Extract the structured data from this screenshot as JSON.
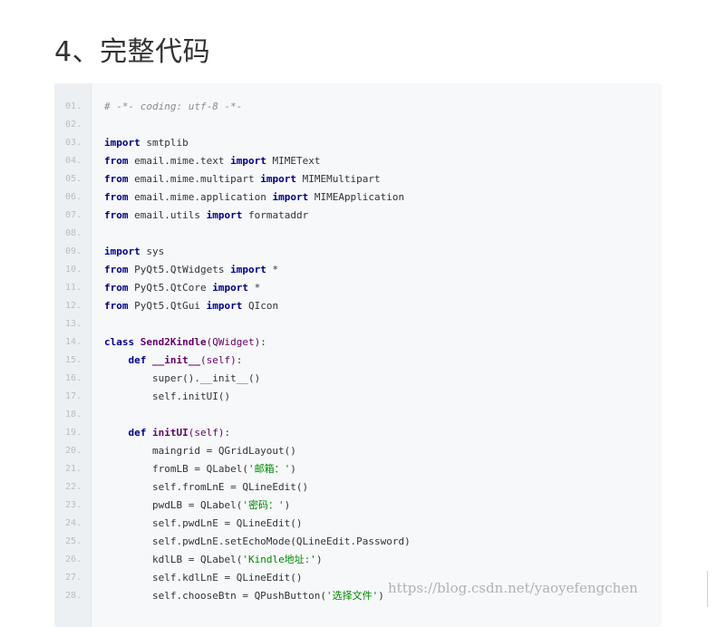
{
  "heading": "4、完整代码",
  "watermark": "https://blog.csdn.net/yaoyefengchen",
  "colors": {
    "code_bg": "#f6f8fa",
    "keyword": "#000088",
    "comment": "#8c8c8c",
    "string": "#008800",
    "func": "#660066"
  },
  "code_lines": [
    {
      "num": "01.",
      "tokens": [
        {
          "t": "# -*- coding: utf-8 -*-",
          "c": "cm"
        }
      ]
    },
    {
      "num": "02.",
      "tokens": []
    },
    {
      "num": "03.",
      "tokens": [
        {
          "t": "import",
          "c": "kw"
        },
        {
          "t": " smtplib",
          "c": ""
        }
      ]
    },
    {
      "num": "04.",
      "tokens": [
        {
          "t": "from",
          "c": "kw"
        },
        {
          "t": " email.mime.text ",
          "c": ""
        },
        {
          "t": "import",
          "c": "kw"
        },
        {
          "t": " MIMEText",
          "c": ""
        }
      ]
    },
    {
      "num": "05.",
      "tokens": [
        {
          "t": "from",
          "c": "kw"
        },
        {
          "t": " email.mime.multipart ",
          "c": ""
        },
        {
          "t": "import",
          "c": "kw"
        },
        {
          "t": " MIMEMultipart",
          "c": ""
        }
      ]
    },
    {
      "num": "06.",
      "tokens": [
        {
          "t": "from",
          "c": "kw"
        },
        {
          "t": " email.mime.application ",
          "c": ""
        },
        {
          "t": "import",
          "c": "kw"
        },
        {
          "t": " MIMEApplication",
          "c": ""
        }
      ]
    },
    {
      "num": "07.",
      "tokens": [
        {
          "t": "from",
          "c": "kw"
        },
        {
          "t": " email.utils ",
          "c": ""
        },
        {
          "t": "import",
          "c": "kw"
        },
        {
          "t": " formataddr",
          "c": ""
        }
      ]
    },
    {
      "num": "08.",
      "tokens": []
    },
    {
      "num": "09.",
      "tokens": [
        {
          "t": "import",
          "c": "kw"
        },
        {
          "t": " sys",
          "c": ""
        }
      ]
    },
    {
      "num": "10.",
      "tokens": [
        {
          "t": "from",
          "c": "kw"
        },
        {
          "t": " PyQt5.QtWidgets ",
          "c": ""
        },
        {
          "t": "import",
          "c": "kw"
        },
        {
          "t": " *",
          "c": ""
        }
      ]
    },
    {
      "num": "11.",
      "tokens": [
        {
          "t": "from",
          "c": "kw"
        },
        {
          "t": " PyQt5.QtCore ",
          "c": ""
        },
        {
          "t": "import",
          "c": "kw"
        },
        {
          "t": " *",
          "c": ""
        }
      ]
    },
    {
      "num": "12.",
      "tokens": [
        {
          "t": "from",
          "c": "kw"
        },
        {
          "t": " PyQt5.QtGui ",
          "c": ""
        },
        {
          "t": "import",
          "c": "kw"
        },
        {
          "t": " QIcon",
          "c": ""
        }
      ]
    },
    {
      "num": "13.",
      "tokens": []
    },
    {
      "num": "14.",
      "tokens": [
        {
          "t": "class",
          "c": "kw"
        },
        {
          "t": " ",
          "c": ""
        },
        {
          "t": "Send2Kindle",
          "c": "fn"
        },
        {
          "t": "(QWidget)",
          "c": "par"
        },
        {
          "t": ":",
          "c": ""
        }
      ]
    },
    {
      "num": "15.",
      "tokens": [
        {
          "t": "    ",
          "c": ""
        },
        {
          "t": "def",
          "c": "kw"
        },
        {
          "t": " ",
          "c": ""
        },
        {
          "t": "__init__",
          "c": "fn"
        },
        {
          "t": "(self)",
          "c": "par"
        },
        {
          "t": ":",
          "c": ""
        }
      ]
    },
    {
      "num": "16.",
      "tokens": [
        {
          "t": "        super().__init__()",
          "c": ""
        }
      ]
    },
    {
      "num": "17.",
      "tokens": [
        {
          "t": "        self.initUI()",
          "c": ""
        }
      ]
    },
    {
      "num": "18.",
      "tokens": []
    },
    {
      "num": "19.",
      "tokens": [
        {
          "t": "    ",
          "c": ""
        },
        {
          "t": "def",
          "c": "kw"
        },
        {
          "t": " ",
          "c": ""
        },
        {
          "t": "initUI",
          "c": "fn"
        },
        {
          "t": "(self)",
          "c": "par"
        },
        {
          "t": ":",
          "c": ""
        }
      ]
    },
    {
      "num": "20.",
      "tokens": [
        {
          "t": "        maingrid = QGridLayout()",
          "c": ""
        }
      ]
    },
    {
      "num": "21.",
      "tokens": [
        {
          "t": "        fromLB = QLabel(",
          "c": ""
        },
        {
          "t": "'邮箱：'",
          "c": "str"
        },
        {
          "t": ")",
          "c": ""
        }
      ]
    },
    {
      "num": "22.",
      "tokens": [
        {
          "t": "        self.fromLnE = QLineEdit()",
          "c": ""
        }
      ]
    },
    {
      "num": "23.",
      "tokens": [
        {
          "t": "        pwdLB = QLabel(",
          "c": ""
        },
        {
          "t": "'密码：'",
          "c": "str"
        },
        {
          "t": ")",
          "c": ""
        }
      ]
    },
    {
      "num": "24.",
      "tokens": [
        {
          "t": "        self.pwdLnE = QLineEdit()",
          "c": ""
        }
      ]
    },
    {
      "num": "25.",
      "tokens": [
        {
          "t": "        self.pwdLnE.setEchoMode(QLineEdit.Password)",
          "c": ""
        }
      ]
    },
    {
      "num": "26.",
      "tokens": [
        {
          "t": "        kdlLB = QLabel(",
          "c": ""
        },
        {
          "t": "'Kindle地址:'",
          "c": "str"
        },
        {
          "t": ")",
          "c": ""
        }
      ]
    },
    {
      "num": "27.",
      "tokens": [
        {
          "t": "        self.kdlLnE = QLineEdit()",
          "c": ""
        }
      ]
    },
    {
      "num": "28.",
      "tokens": [
        {
          "t": "        self.chooseBtn = QPushButton(",
          "c": ""
        },
        {
          "t": "'选择文件'",
          "c": "str"
        },
        {
          "t": ")",
          "c": ""
        }
      ]
    }
  ]
}
